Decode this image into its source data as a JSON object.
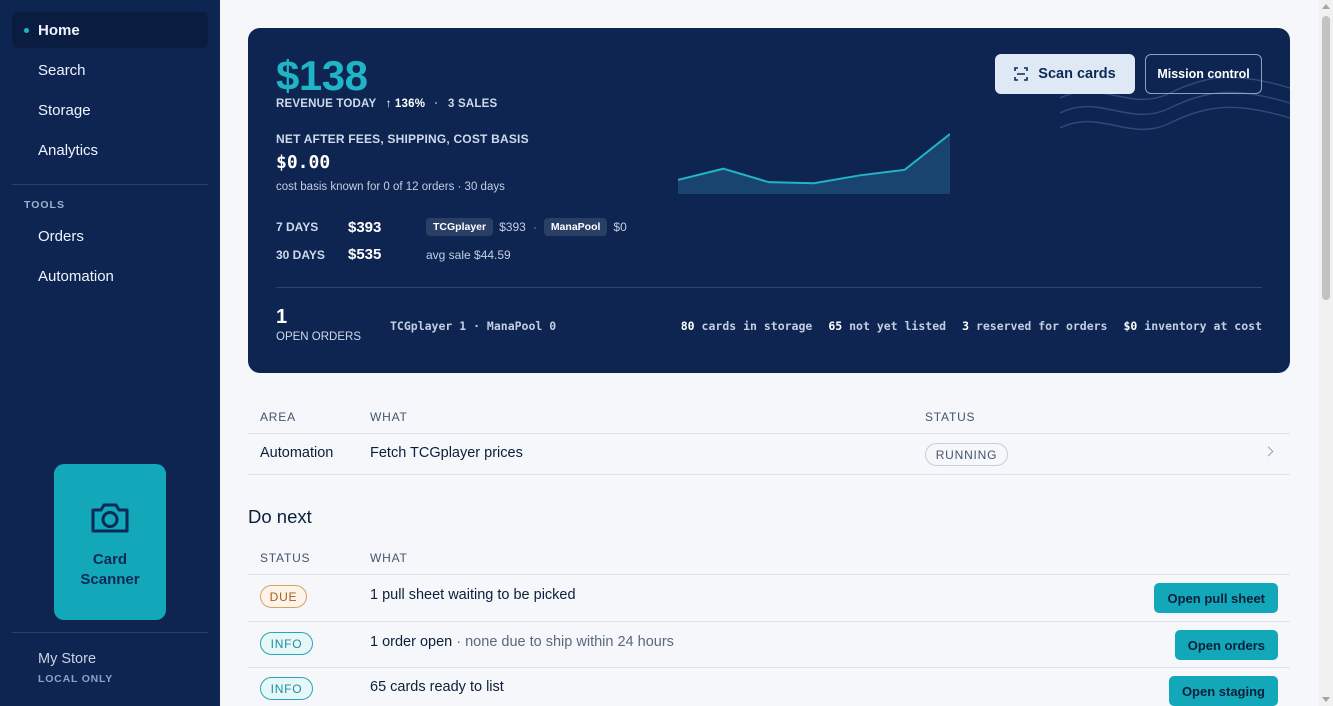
{
  "sidebar": {
    "nav": [
      {
        "label": "Home",
        "active": true
      },
      {
        "label": "Search"
      },
      {
        "label": "Storage"
      },
      {
        "label": "Analytics"
      }
    ],
    "tools_heading": "TOOLS",
    "tools": [
      {
        "label": "Orders"
      },
      {
        "label": "Automation"
      }
    ],
    "scanner": {
      "label_line1": "Card",
      "label_line2": "Scanner",
      "icon": "camera-icon"
    },
    "store": {
      "name": "My Store",
      "mode": "LOCAL ONLY"
    }
  },
  "hero": {
    "revenue": "$138",
    "revenue_label": "REVENUE TODAY",
    "change": "↑ 136%",
    "sales": "3 SALES",
    "net_label": "NET AFTER FEES, SHIPPING, COST BASIS",
    "net_value": "$0.00",
    "net_note": "cost basis known for 0 of 12 orders · 30 days",
    "stats": [
      {
        "period": "7 DAYS",
        "amount": "$393"
      },
      {
        "period": "30 DAYS",
        "amount": "$535"
      }
    ],
    "breakdown": [
      {
        "platform": "TCGplayer",
        "amount": "$393"
      },
      {
        "platform": "ManaPool",
        "amount": "$0"
      }
    ],
    "avg_sale": "avg sale $44.59",
    "open_orders_count": "1",
    "open_orders_label": "OPEN ORDERS",
    "platform_orders": "TCGplayer 1 · ManaPool 0",
    "inventory": [
      {
        "value": "80",
        "label": "cards in storage"
      },
      {
        "value": "65",
        "label": "not yet listed"
      },
      {
        "value": "3",
        "label": "reserved for orders"
      },
      {
        "value": "$0",
        "label": "inventory at cost"
      }
    ],
    "scan_button": "Scan cards",
    "mission_button": "Mission control",
    "sparkline": [
      0.18,
      0.38,
      0.14,
      0.12,
      0.26,
      0.36,
      1.0
    ],
    "accent": "#1fb5c6"
  },
  "activity": {
    "headers": [
      "AREA",
      "WHAT",
      "STATUS"
    ],
    "rows": [
      {
        "area": "Automation",
        "what": "Fetch TCGplayer prices",
        "status": "RUNNING"
      }
    ]
  },
  "do_next": {
    "title": "Do next",
    "headers": [
      "STATUS",
      "WHAT"
    ],
    "rows": [
      {
        "status": "DUE",
        "what": "1 pull sheet waiting to be picked",
        "detail": "",
        "action": "Open pull sheet"
      },
      {
        "status": "INFO",
        "what": "1 order open",
        "detail": " · none due to ship within 24 hours",
        "action": "Open orders"
      },
      {
        "status": "INFO",
        "what": "65 cards ready to list",
        "detail": "",
        "action": "Open staging"
      }
    ]
  }
}
